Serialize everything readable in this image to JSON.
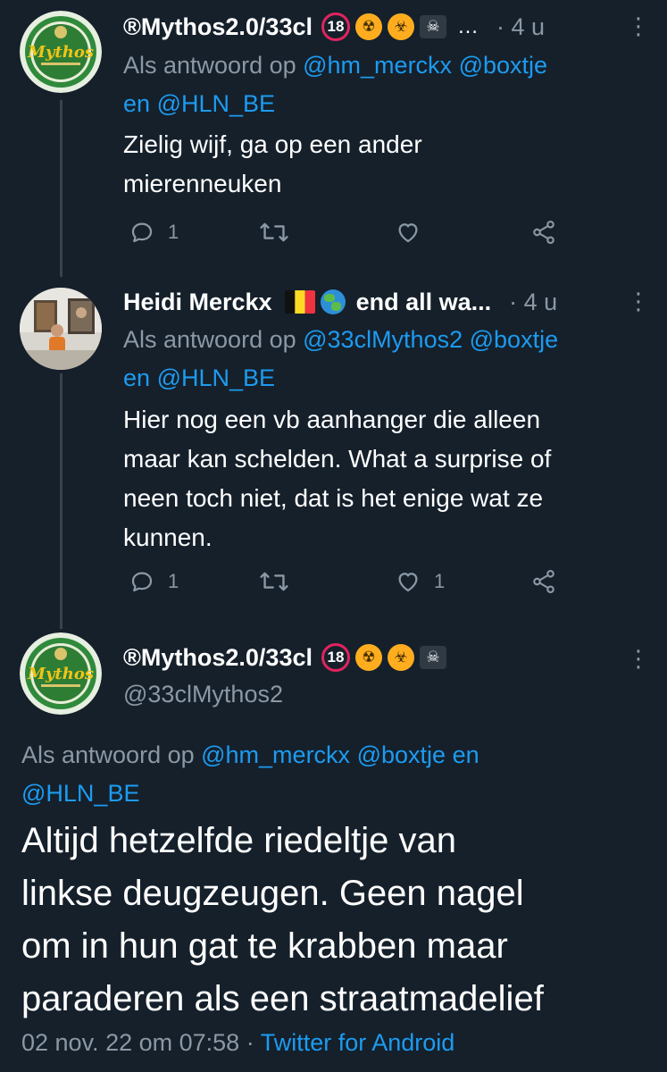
{
  "tweets": [
    {
      "name": "®Mythos2.0/33cl",
      "badges": [
        "18-badge",
        "nuke-badge",
        "bio-badge",
        "skull-badge"
      ],
      "badge_text": [
        "18",
        "☢",
        "☣",
        "☠"
      ],
      "truncation": "…",
      "time": "· 4 u",
      "reply_prefix": "Als antwoord op ",
      "mentions": [
        "@hm_merckx",
        "@boxtje",
        "@HLN_BE"
      ],
      "reply_and": "en",
      "text_lines": [
        "Zielig wijf, ga op een ander",
        "mierenneuken"
      ],
      "reply_count": "1",
      "retweet_count": "",
      "like_count": ""
    },
    {
      "name": "Heidi Merckx",
      "extra_name": "end all wa...",
      "time": "· 4 u",
      "reply_prefix": "Als antwoord op ",
      "mentions": [
        "@33clMythos2",
        "@boxtje",
        "@HLN_BE"
      ],
      "reply_and": "en",
      "text_lines": [
        "Hier nog een vb aanhanger die alleen",
        "maar kan schelden. What a surprise of",
        "neen toch niet, dat is het enige wat ze",
        "kunnen."
      ],
      "reply_count": "1",
      "retweet_count": "",
      "like_count": "1"
    }
  ],
  "main_tweet": {
    "name": "®Mythos2.0/33cl",
    "badge_text": [
      "18",
      "☢",
      "☣",
      "☠"
    ],
    "handle": "@33clMythos2",
    "reply_prefix": "Als antwoord op ",
    "mentions": [
      "@hm_merckx",
      "@boxtje",
      "@HLN_BE"
    ],
    "reply_and": "en",
    "text_lines": [
      "Altijd hetzelfde riedeltje van",
      "linkse deugzeugen. Geen nagel",
      "om in hun gat te krabben maar",
      "paraderen als een straatmadelief"
    ],
    "timestamp": "02 nov. 22 om 07:58",
    "dot": "·",
    "source": "Twitter for Android"
  },
  "colors": {
    "background": "#15202b",
    "text": "#ffffff",
    "muted": "#8b98a5",
    "link": "#1d9bf0",
    "thread_line": "#38444d"
  },
  "icons": {
    "more": "⋮"
  }
}
